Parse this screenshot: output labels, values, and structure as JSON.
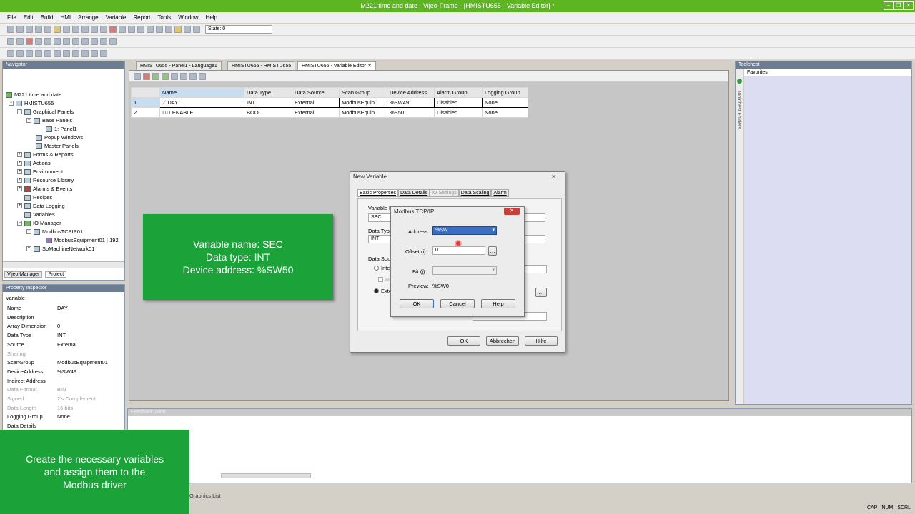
{
  "window": {
    "title": "M221 time and date - Vijeo-Frame - [HMISTU655 - Variable Editor] *"
  },
  "menu": [
    "File",
    "Edit",
    "Build",
    "HMI",
    "Arrange",
    "Variable",
    "Report",
    "Tools",
    "Window",
    "Help"
  ],
  "toolbar": {
    "state_label": "State: 0"
  },
  "navigator": {
    "title": "Navigator",
    "items": [
      {
        "label": "M221 time and date"
      },
      {
        "label": "HMISTU655"
      },
      {
        "label": "Graphical Panels"
      },
      {
        "label": "Base Panels"
      },
      {
        "label": "1: Panel1"
      },
      {
        "label": "Popup Windows"
      },
      {
        "label": "Master Panels"
      },
      {
        "label": "Forms & Reports"
      },
      {
        "label": "Actions"
      },
      {
        "label": "Environment"
      },
      {
        "label": "Resource Library"
      },
      {
        "label": "Alarms & Events"
      },
      {
        "label": "Recipes"
      },
      {
        "label": "Data Logging"
      },
      {
        "label": "Variables"
      },
      {
        "label": "IO Manager"
      },
      {
        "label": "ModbusTCPIP01"
      },
      {
        "label": "ModbusEquipment01 [ 192."
      },
      {
        "label": "SoMachineNetwork01"
      }
    ],
    "tabs": [
      "Vijeo-Manager",
      "Project"
    ]
  },
  "property_inspector": {
    "title": "Property Inspector",
    "section": "Variable",
    "rows": [
      {
        "k": "Name",
        "v": "DAY",
        "grey": false
      },
      {
        "k": "Description",
        "v": "",
        "grey": false
      },
      {
        "k": "Array Dimension",
        "v": "0",
        "grey": false
      },
      {
        "k": "Data Type",
        "v": "INT",
        "grey": false
      },
      {
        "k": "Source",
        "v": "External",
        "grey": false
      },
      {
        "k": "Sharing",
        "v": "",
        "grey": true
      },
      {
        "k": "ScanGroup",
        "v": "ModbusEquipment01",
        "grey": false
      },
      {
        "k": "DeviceAddress",
        "v": "%SW49",
        "grey": false
      },
      {
        "k": "Indirect Address",
        "v": "",
        "grey": false
      },
      {
        "k": "Data Format",
        "v": "BIN",
        "grey": true
      },
      {
        "k": "Signed",
        "v": "2's Complement",
        "grey": true
      },
      {
        "k": "Data Length",
        "v": "16 bits",
        "grey": true
      },
      {
        "k": "Logging Group",
        "v": "None",
        "grey": false
      },
      {
        "k": "Data Details",
        "v": "",
        "grey": false
      }
    ]
  },
  "editor_tabs": [
    "HMISTU655 - Panel1 - Language1",
    "HMISTU655 - HMISTU655",
    "HMISTU655 - Variable Editor"
  ],
  "variable_table": {
    "columns": [
      "Name",
      "Data Type",
      "Data Source",
      "Scan Group",
      "Device Address",
      "Alarm Group",
      "Logging Group"
    ],
    "rows": [
      {
        "num": "1",
        "name": "DAY",
        "type": "INT",
        "source": "External",
        "scan": "ModbusEquip...",
        "addr": "%SW49",
        "alarm": "Disabled",
        "log": "None"
      },
      {
        "num": "2",
        "name": "ENABLE",
        "type": "BOOL",
        "source": "External",
        "scan": "ModbusEquip...",
        "addr": "%S50",
        "alarm": "Disabled",
        "log": "None"
      }
    ]
  },
  "new_variable_dialog": {
    "title": "New Variable",
    "tabs": [
      "Basic Properties",
      "Data Details",
      "IO Settings",
      "Data Scaling",
      "Alarm"
    ],
    "name_label": "Variable N",
    "name_value": "SEC",
    "type_label": "Data Typ",
    "type_value": "INT",
    "source_label": "Data Sou",
    "radio_internal": "Inte",
    "check_label": "Re",
    "radio_external": "Exte",
    "ok": "OK",
    "cancel": "Abbrechen",
    "help": "Hilfe"
  },
  "modbus_dialog": {
    "title": "Modbus TCP/IP",
    "address_label": "Address:",
    "address_value": "%SW",
    "offset_label": "Offset (i):",
    "offset_value": "0",
    "bit_label": "Bit (j):",
    "preview_label": "Preview:",
    "preview_value": "%SW0",
    "ok": "OK",
    "cancel": "Cancel",
    "help": "Help"
  },
  "callout_main": {
    "line1": "Variable name: SEC",
    "line2": "Data type: INT",
    "line3": "Device address: %SW50"
  },
  "callout_bottom": {
    "line1": "Create the necessary variables",
    "line2": "and assign them to the",
    "line3": "Modbus driver"
  },
  "toolchest": {
    "title": "Toolchest",
    "favorites": "Favorites",
    "side_label": "Toolchest Folders"
  },
  "feedback": {
    "title": "Feedback Zone"
  },
  "bottom_tabs": {
    "graphics_list": "Graphics List"
  },
  "status": {
    "cap": "CAP",
    "num": "NUM",
    "scrl": "SCRL"
  }
}
